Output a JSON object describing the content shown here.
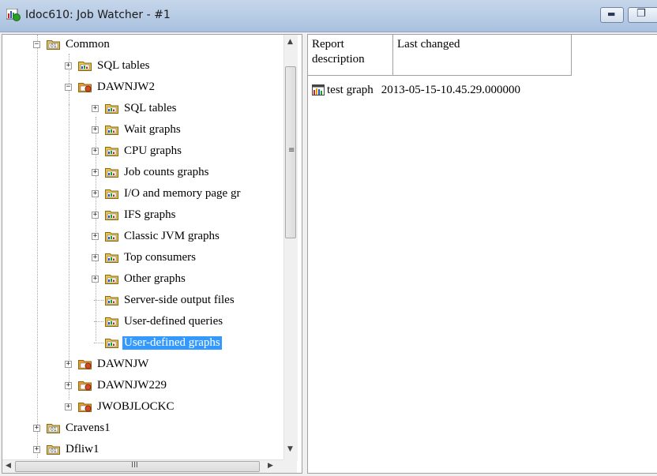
{
  "window": {
    "title": "Idoc610: Job Watcher - #1",
    "minimize_glyph": "▬",
    "maximize_glyph": "❐"
  },
  "tree": {
    "nodes": [
      {
        "label": "Common",
        "expander": "−",
        "icon": "database-folder-icon"
      },
      {
        "label": "SQL tables",
        "expander": "+",
        "icon": "folder-icon"
      },
      {
        "label": "DAWNJW2",
        "expander": "−",
        "icon": "collection-folder-icon"
      },
      {
        "label": "SQL tables",
        "expander": "+",
        "icon": "folder-icon"
      },
      {
        "label": "Wait graphs",
        "expander": "+",
        "icon": "folder-icon"
      },
      {
        "label": "CPU graphs",
        "expander": "+",
        "icon": "folder-icon"
      },
      {
        "label": "Job counts graphs",
        "expander": "+",
        "icon": "folder-icon"
      },
      {
        "label": "I/O and memory page gr",
        "expander": "+",
        "icon": "folder-icon"
      },
      {
        "label": "IFS graphs",
        "expander": "+",
        "icon": "folder-icon"
      },
      {
        "label": "Classic JVM graphs",
        "expander": "+",
        "icon": "folder-icon"
      },
      {
        "label": "Top consumers",
        "expander": "+",
        "icon": "folder-icon"
      },
      {
        "label": "Other graphs",
        "expander": "+",
        "icon": "folder-icon"
      },
      {
        "label": "Server-side output files",
        "expander": "",
        "icon": "folder-icon"
      },
      {
        "label": "User-defined queries",
        "expander": "",
        "icon": "folder-icon"
      },
      {
        "label": "User-defined graphs",
        "expander": "",
        "icon": "folder-icon",
        "selected": true
      },
      {
        "label": "DAWNJW",
        "expander": "+",
        "icon": "collection-folder-icon"
      },
      {
        "label": "DAWNJW229",
        "expander": "+",
        "icon": "collection-folder-icon"
      },
      {
        "label": "JWOBJLOCKC",
        "expander": "+",
        "icon": "collection-folder-icon"
      },
      {
        "label": "Cravens1",
        "expander": "+",
        "icon": "database-folder-icon"
      },
      {
        "label": "Dfliw1",
        "expander": "+",
        "icon": "database-folder-icon"
      }
    ],
    "hscroll_grip": "III"
  },
  "list": {
    "columns": [
      {
        "label": "Report description"
      },
      {
        "label": "Last changed"
      }
    ],
    "rows": [
      {
        "description": "test graph",
        "last_changed": "2013-05-15-10.45.29.000000",
        "icon": "graph-icon"
      }
    ]
  }
}
